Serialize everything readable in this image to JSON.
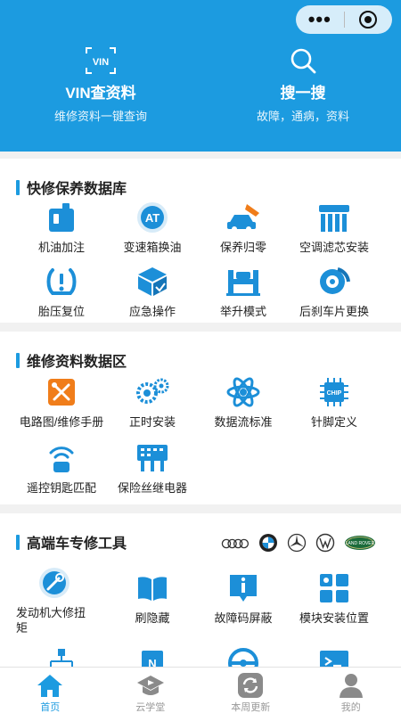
{
  "colors": {
    "accent": "#1c9be0",
    "icon_blue": "#1c8fd8",
    "icon_orange": "#f07d1a",
    "tab_inactive": "#9a9a9a"
  },
  "capsule": {
    "menu_icon": "more-dots-icon",
    "close_icon": "target-icon"
  },
  "header": {
    "vin": {
      "icon": "vin-scan-icon",
      "icon_text": "VIN",
      "title": "VIN查资料",
      "subtitle": "维修资料一键查询"
    },
    "search": {
      "icon": "search-icon",
      "title": "搜一搜",
      "subtitle": "故障，通病，资料"
    }
  },
  "quick_repair": {
    "title": "快修保养数据库",
    "items": [
      {
        "label": "机油加注",
        "icon": "oil-can-icon"
      },
      {
        "label": "变速箱换油",
        "icon": "at-transmission-icon",
        "icon_text": "AT"
      },
      {
        "label": "保养归零",
        "icon": "maintenance-reset-icon"
      },
      {
        "label": "空调滤芯安装",
        "icon": "ac-filter-icon"
      },
      {
        "label": "胎压复位",
        "icon": "tire-pressure-icon"
      },
      {
        "label": "应急操作",
        "icon": "emergency-box-icon"
      },
      {
        "label": "举升模式",
        "icon": "lift-icon"
      },
      {
        "label": "后刹车片更换",
        "icon": "brake-disc-icon"
      }
    ]
  },
  "repair_data": {
    "title": "维修资料数据区",
    "items": [
      {
        "label": "电路图/维修手册",
        "icon": "circuit-manual-icon"
      },
      {
        "label": "正时安装",
        "icon": "timing-gears-icon"
      },
      {
        "label": "数据流标准",
        "icon": "data-atom-icon"
      },
      {
        "label": "针脚定义",
        "icon": "chip-pin-icon",
        "icon_text": "CHIP"
      },
      {
        "label": "遥控钥匙匹配",
        "icon": "remote-key-icon"
      },
      {
        "label": "保险丝继电器",
        "icon": "fuse-relay-icon"
      }
    ]
  },
  "premium_tools": {
    "title": "高端车专修工具",
    "brands": [
      "audi-logo-icon",
      "bmw-logo-icon",
      "mercedes-logo-icon",
      "vw-logo-icon",
      "land-rover-logo-icon"
    ],
    "brand_text": {
      "land_rover": "LAND ROVER"
    },
    "items": [
      {
        "label": "发动机大修扭矩",
        "icon": "torque-wrench-icon"
      },
      {
        "label": "刷隐藏",
        "icon": "hidden-feature-book-icon"
      },
      {
        "label": "故障码屏蔽",
        "icon": "fault-code-icon"
      },
      {
        "label": "模块安装位置",
        "icon": "module-location-icon"
      }
    ],
    "partial_icons": [
      "network-tree-icon",
      "n-chip-icon",
      "steering-wheel-icon",
      "terminal-icon"
    ]
  },
  "tabbar": [
    {
      "label": "首页",
      "icon": "home-icon",
      "active": true
    },
    {
      "label": "云学堂",
      "icon": "graduation-cap-icon",
      "active": false
    },
    {
      "label": "本周更新",
      "icon": "refresh-icon",
      "active": false
    },
    {
      "label": "我的",
      "icon": "user-icon",
      "active": false
    }
  ]
}
